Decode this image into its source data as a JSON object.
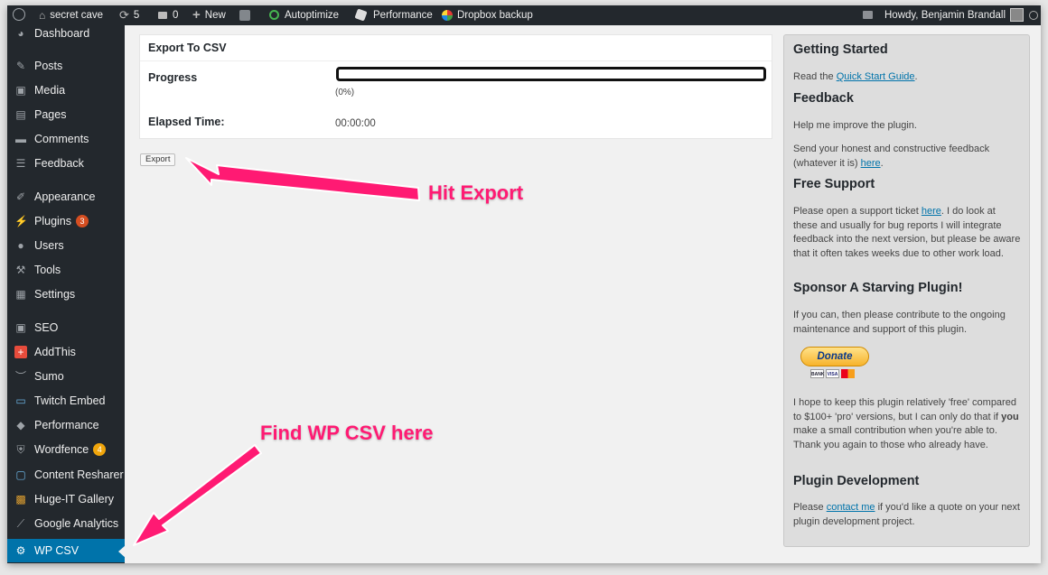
{
  "adminbar": {
    "site_name": "secret cave",
    "updates_count": "5",
    "comments_count": "0",
    "new_label": "New",
    "autoptimize_label": "Autoptimize",
    "performance_label": "Performance",
    "dropbox_label": "Dropbox backup",
    "howdy_label": "Howdy, Benjamin Brandall"
  },
  "sidebar": {
    "items": [
      {
        "label": "Dashboard",
        "icon": "dashboard-icon"
      },
      {
        "label": "Posts",
        "icon": "pin-icon"
      },
      {
        "label": "Media",
        "icon": "media-icon"
      },
      {
        "label": "Pages",
        "icon": "pages-icon"
      },
      {
        "label": "Comments",
        "icon": "comment-icon"
      },
      {
        "label": "Feedback",
        "icon": "feedback-icon"
      },
      {
        "label": "Appearance",
        "icon": "brush-icon"
      },
      {
        "label": "Plugins",
        "icon": "plug-icon",
        "badge": "3"
      },
      {
        "label": "Users",
        "icon": "user-icon"
      },
      {
        "label": "Tools",
        "icon": "wrench-icon"
      },
      {
        "label": "Settings",
        "icon": "settings-icon"
      },
      {
        "label": "SEO",
        "icon": "yoast-icon"
      },
      {
        "label": "AddThis",
        "icon": "addthis-icon"
      },
      {
        "label": "Sumo",
        "icon": "sumo-icon"
      },
      {
        "label": "Twitch Embed",
        "icon": "twitch-icon"
      },
      {
        "label": "Performance",
        "icon": "cube-icon"
      },
      {
        "label": "Wordfence",
        "icon": "wordfence-icon",
        "badge": "4"
      },
      {
        "label": "Content Resharer",
        "icon": "robot-icon"
      },
      {
        "label": "Huge-IT Gallery",
        "icon": "gallery-icon"
      },
      {
        "label": "Google Analytics",
        "icon": "analytics-icon"
      },
      {
        "label": "WP CSV",
        "icon": "gear-icon"
      }
    ]
  },
  "export_panel": {
    "title": "Export To CSV",
    "progress_label": "Progress",
    "progress_value": 0,
    "progress_text": "(0%)",
    "elapsed_label": "Elapsed Time:",
    "elapsed_value": "00:00:00",
    "export_button": "Export"
  },
  "right_sidebar": {
    "getting_started_title": "Getting Started",
    "getting_started_pre": "Read the ",
    "getting_started_link": "Quick Start Guide",
    "getting_started_post": ".",
    "feedback_title": "Feedback",
    "feedback_p1": "Help me improve the plugin.",
    "feedback_p2_pre": "Send your honest and constructive feedback (whatever it is) ",
    "feedback_p2_link": "here",
    "feedback_p2_post": ".",
    "support_title": "Free Support",
    "support_pre": "Please open a support ticket ",
    "support_link": "here",
    "support_post": ". I do look at these and usually for bug reports I will integrate feedback into the next version, but please be aware that it often takes weeks due to other work load.",
    "sponsor_title": "Sponsor A Starving Plugin!",
    "sponsor_p": "If you can, then please contribute to the ongoing maintenance and support of this plugin.",
    "donate_label": "Donate",
    "cards": [
      "BANK",
      "VISA",
      "MC"
    ],
    "sponsor_p2_pre": "I hope to keep this plugin relatively 'free' compared to $100+ 'pro' versions, but I can only do that if ",
    "sponsor_p2_bold": "you",
    "sponsor_p2_post": " make a small contribution when you're able to. Thank you again to those who already have.",
    "dev_title": "Plugin Development",
    "dev_pre": "Please ",
    "dev_link": "contact me",
    "dev_post": " if you'd like a quote on your next plugin development project."
  },
  "annotations": {
    "hit_export": "Hit Export",
    "find_wp_csv": "Find WP CSV here",
    "color": "#ff1a73"
  }
}
